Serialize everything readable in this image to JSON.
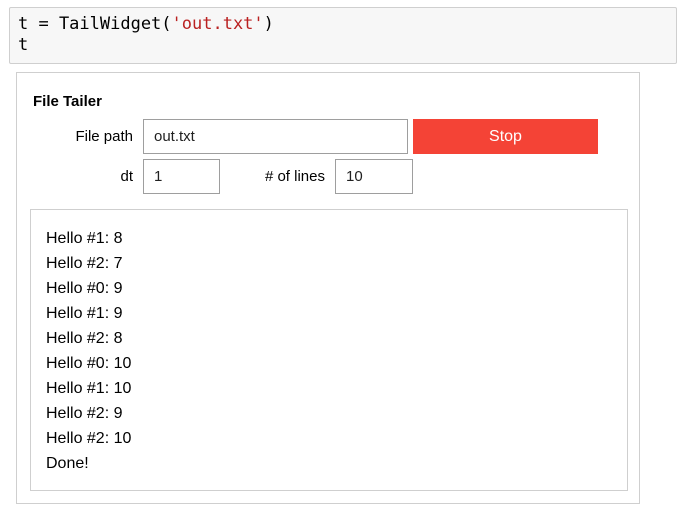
{
  "code_cell": {
    "line1_var": "t = TailWidget(",
    "line1_string": "'out.txt'",
    "line1_close": ")",
    "line2": "t"
  },
  "widget": {
    "title": "File Tailer",
    "file_path_label": "File path",
    "file_path_value": "out.txt",
    "stop_label": "Stop",
    "dt_label": "dt",
    "dt_value": "1",
    "lines_label": "# of lines",
    "lines_value": "10"
  },
  "log": {
    "lines": [
      "Hello #1: 8",
      "Hello #2: 7",
      "Hello #0: 9",
      "Hello #1: 9",
      "Hello #2: 8",
      "Hello #0: 10",
      "Hello #1: 10",
      "Hello #2: 9",
      "Hello #2: 10",
      "Done!"
    ]
  },
  "colors": {
    "stop_button": "#f44336",
    "code_string": "#ba2121"
  }
}
